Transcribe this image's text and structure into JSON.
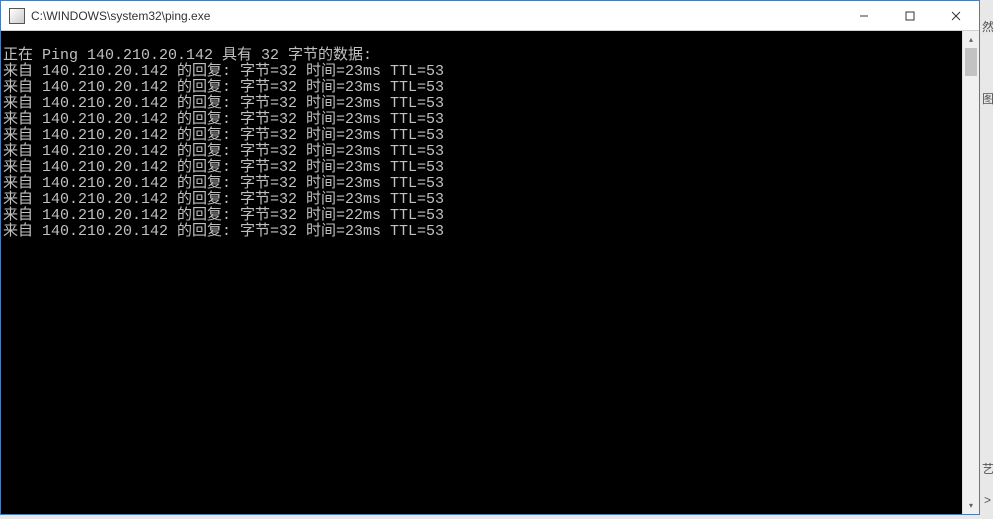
{
  "window": {
    "title": "C:\\WINDOWS\\system32\\ping.exe"
  },
  "console": {
    "header": "正在 Ping 140.210.20.142 具有 32 字节的数据:",
    "pings": [
      {
        "from": "140.210.20.142",
        "bytes": 32,
        "time_ms": 23,
        "ttl": 53
      },
      {
        "from": "140.210.20.142",
        "bytes": 32,
        "time_ms": 23,
        "ttl": 53
      },
      {
        "from": "140.210.20.142",
        "bytes": 32,
        "time_ms": 23,
        "ttl": 53
      },
      {
        "from": "140.210.20.142",
        "bytes": 32,
        "time_ms": 23,
        "ttl": 53
      },
      {
        "from": "140.210.20.142",
        "bytes": 32,
        "time_ms": 23,
        "ttl": 53
      },
      {
        "from": "140.210.20.142",
        "bytes": 32,
        "time_ms": 23,
        "ttl": 53
      },
      {
        "from": "140.210.20.142",
        "bytes": 32,
        "time_ms": 23,
        "ttl": 53
      },
      {
        "from": "140.210.20.142",
        "bytes": 32,
        "time_ms": 23,
        "ttl": 53
      },
      {
        "from": "140.210.20.142",
        "bytes": 32,
        "time_ms": 23,
        "ttl": 53
      },
      {
        "from": "140.210.20.142",
        "bytes": 32,
        "time_ms": 22,
        "ttl": 53
      },
      {
        "from": "140.210.20.142",
        "bytes": 32,
        "time_ms": 23,
        "ttl": 53
      }
    ],
    "reply_template": "来自 {from} 的回复: 字节={bytes} 时间={time_ms}ms TTL={ttl}"
  },
  "background_fragments": {
    "f1": "然",
    "f2": "图",
    "f3": "艺",
    "f4": ">"
  }
}
